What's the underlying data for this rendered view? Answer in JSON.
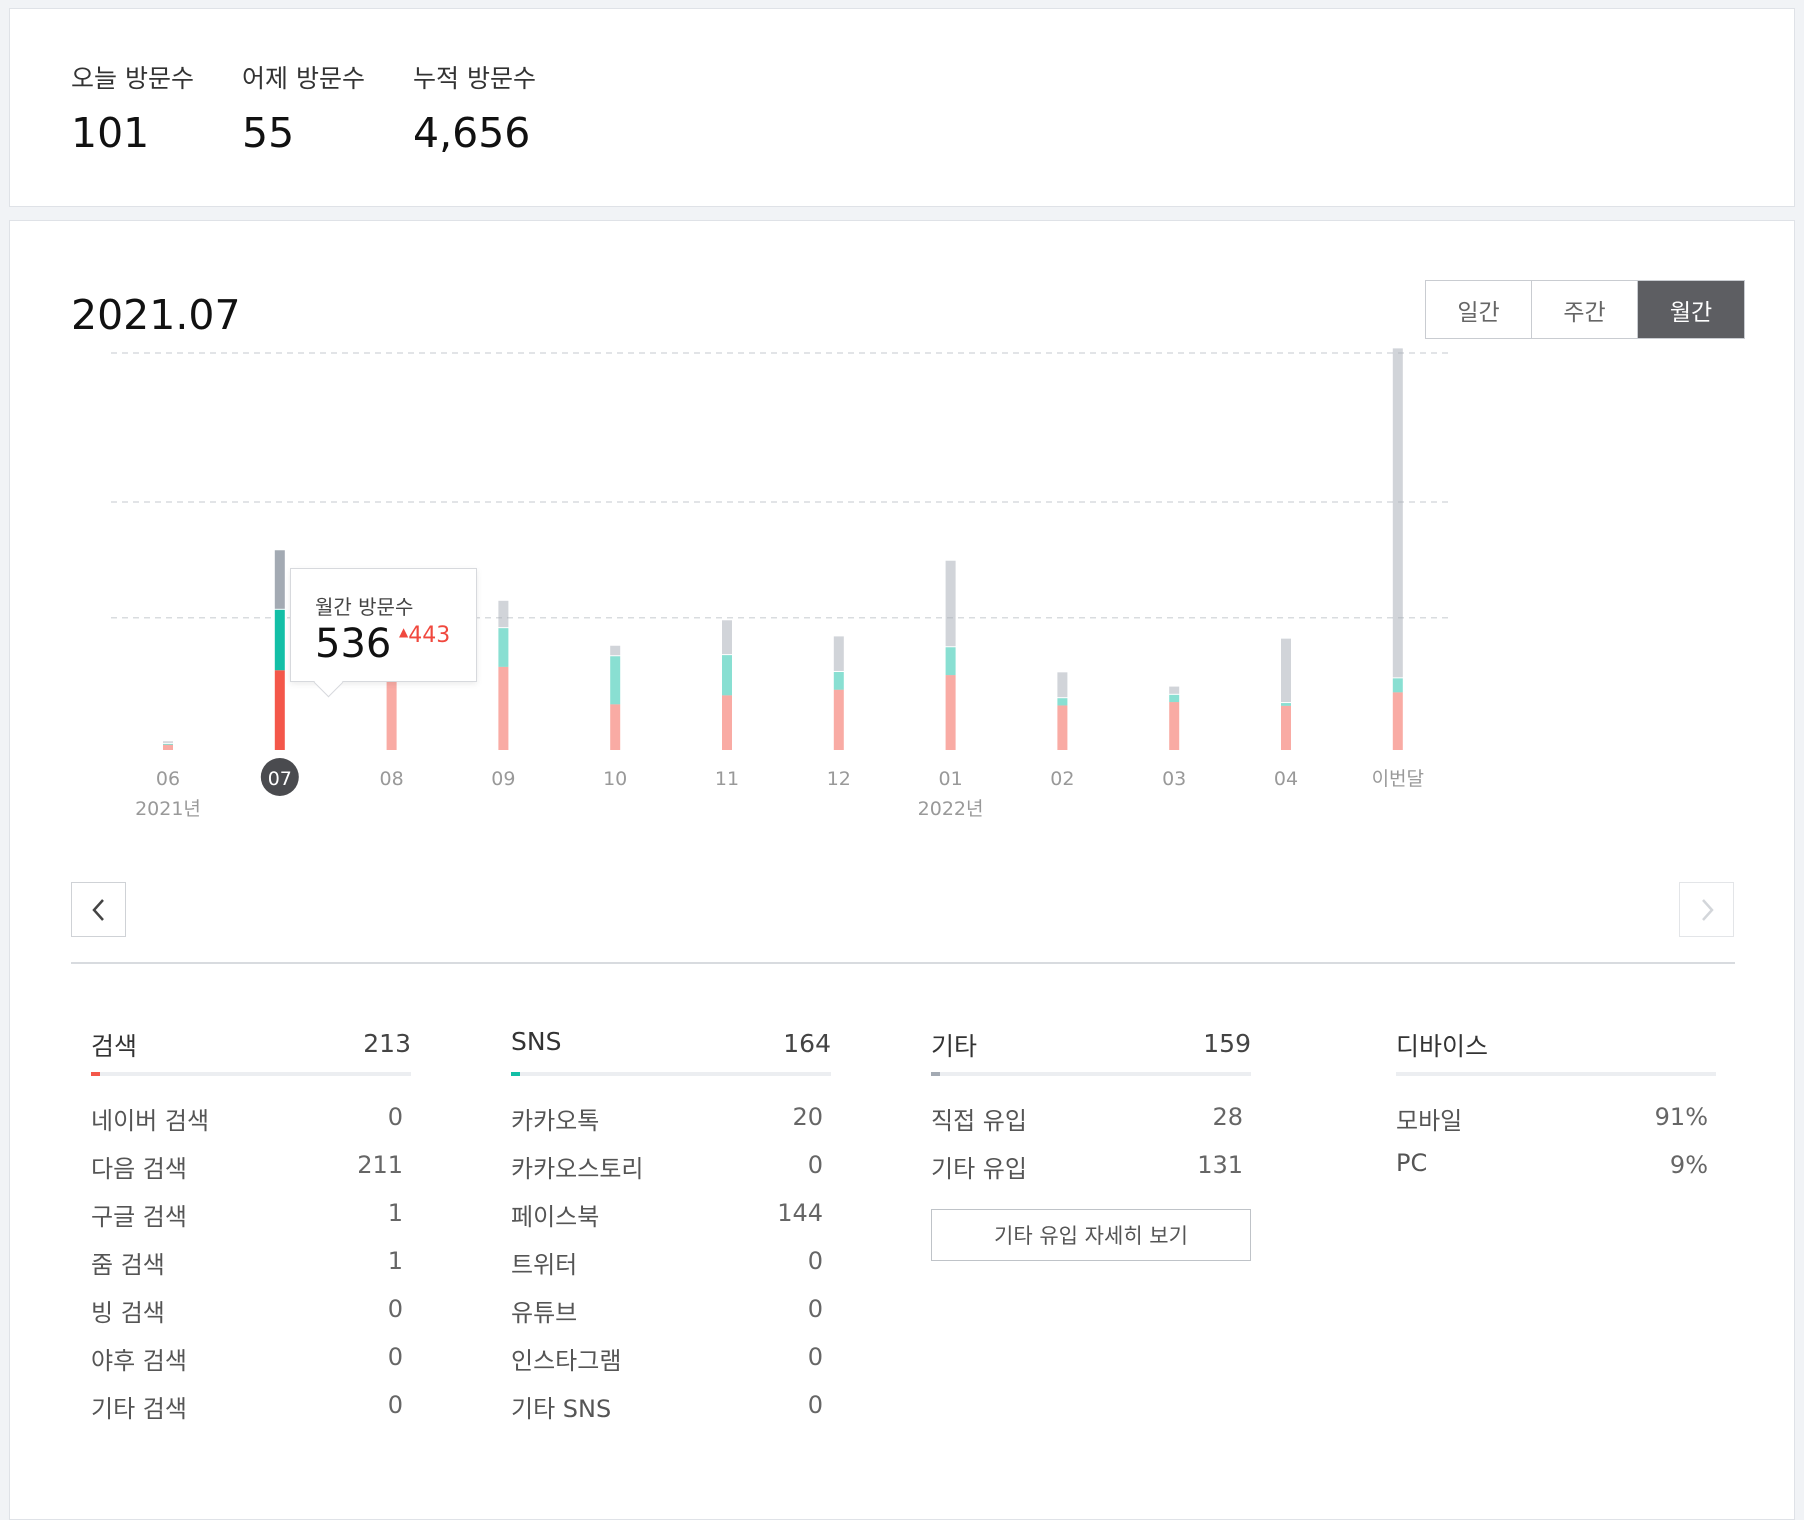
{
  "summary": {
    "today": {
      "label": "오늘 방문수",
      "value": "101"
    },
    "yesterday": {
      "label": "어제 방문수",
      "value": "55"
    },
    "total": {
      "label": "누적 방문수",
      "value": "4,656"
    }
  },
  "period_title": "2021.07",
  "period_toggle": {
    "daily": "일간",
    "weekly": "주간",
    "monthly": "월간",
    "active": "monthly"
  },
  "tooltip": {
    "label": "월간 방문수",
    "value": "536",
    "change": "443",
    "change_color": "#f0483e"
  },
  "colors": {
    "search": "#f4574a",
    "sns": "#13bfa6",
    "other": "#a3aab3"
  },
  "chart_data": {
    "type": "bar",
    "stacked": true,
    "categories": [
      "06",
      "07",
      "08",
      "09",
      "10",
      "11",
      "12",
      "01",
      "02",
      "03",
      "04",
      "이번달"
    ],
    "year_labels": [
      {
        "category": "06",
        "label": "2021년"
      },
      {
        "category": "01",
        "label": "2022년"
      }
    ],
    "selected": "07",
    "series": [
      {
        "values": [
          14,
          213,
          200,
          222,
          122,
          146,
          161,
          200,
          119,
          128,
          118,
          154
        ]
      },
      {
        "values": [
          5,
          164,
          152,
          106,
          131,
          110,
          50,
          77,
          22,
          22,
          10,
          40
        ]
      },
      {
        "values": [
          7,
          159,
          61,
          73,
          28,
          93,
          95,
          231,
          69,
          22,
          172,
          881
        ]
      }
    ],
    "ylim": [
      0,
      1060
    ],
    "grid": true,
    "legend": "none"
  },
  "nav": {
    "prev_icon": "chevron-left-icon",
    "next_icon": "chevron-right-icon"
  },
  "breakdown": {
    "search": {
      "title": "검색",
      "total": "213",
      "items": [
        {
          "label": "네이버 검색",
          "value": "0"
        },
        {
          "label": "다음 검색",
          "value": "211"
        },
        {
          "label": "구글 검색",
          "value": "1"
        },
        {
          "label": "줌 검색",
          "value": "1"
        },
        {
          "label": "빙 검색",
          "value": "0"
        },
        {
          "label": "야후 검색",
          "value": "0"
        },
        {
          "label": "기타 검색",
          "value": "0"
        }
      ]
    },
    "sns": {
      "title": "SNS",
      "total": "164",
      "items": [
        {
          "label": "카카오톡",
          "value": "20"
        },
        {
          "label": "카카오스토리",
          "value": "0"
        },
        {
          "label": "페이스북",
          "value": "144"
        },
        {
          "label": "트위터",
          "value": "0"
        },
        {
          "label": "유튜브",
          "value": "0"
        },
        {
          "label": "인스타그램",
          "value": "0"
        },
        {
          "label": "기타 SNS",
          "value": "0"
        }
      ]
    },
    "other": {
      "title": "기타",
      "total": "159",
      "items": [
        {
          "label": "직접 유입",
          "value": "28"
        },
        {
          "label": "기타 유입",
          "value": "131"
        }
      ],
      "detail_button": "기타 유입 자세히 보기"
    },
    "device": {
      "title": "디바이스",
      "items": [
        {
          "label": "모바일",
          "value": "91%"
        },
        {
          "label": "PC",
          "value": "9%"
        }
      ]
    }
  }
}
